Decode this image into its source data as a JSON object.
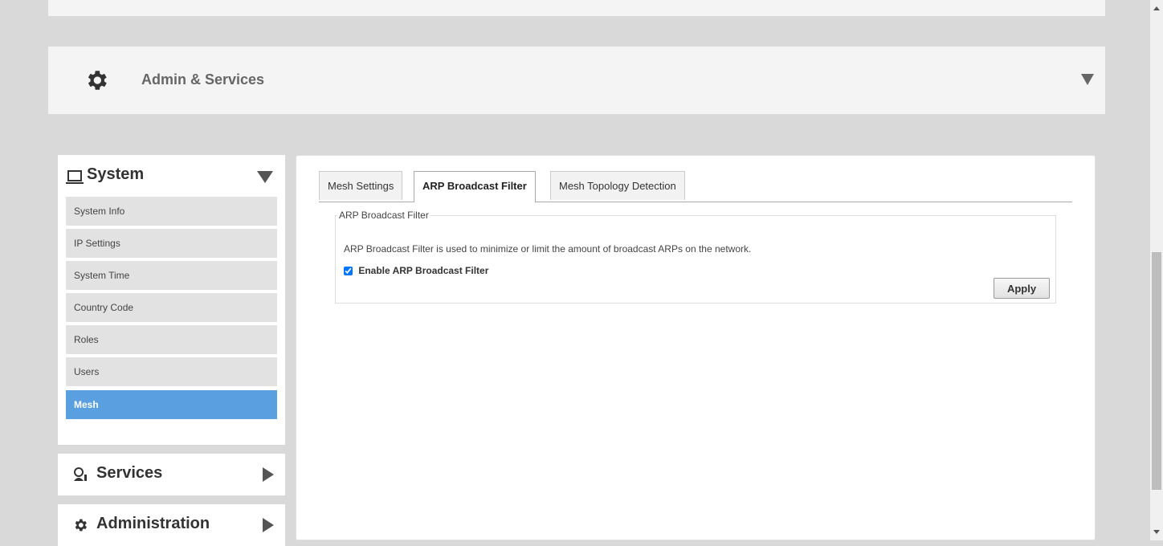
{
  "admin_section": {
    "title": "Admin & Services"
  },
  "sidebar": {
    "system_label": "System",
    "items": [
      {
        "label": "System Info",
        "active": false
      },
      {
        "label": "IP Settings",
        "active": false
      },
      {
        "label": "System Time",
        "active": false
      },
      {
        "label": "Country Code",
        "active": false
      },
      {
        "label": "Roles",
        "active": false
      },
      {
        "label": "Users",
        "active": false
      },
      {
        "label": "Mesh",
        "active": true
      }
    ],
    "services_label": "Services",
    "administration_label": "Administration"
  },
  "tabs": [
    {
      "label": "Mesh Settings",
      "active": false
    },
    {
      "label": "ARP Broadcast Filter",
      "active": true
    },
    {
      "label": "Mesh Topology Detection",
      "active": false
    }
  ],
  "arp_filter": {
    "legend": "ARP Broadcast Filter",
    "description": "ARP Broadcast Filter is used to minimize or limit the amount of broadcast ARPs on the network.",
    "checkbox_label": "Enable ARP Broadcast Filter",
    "checkbox_checked": true,
    "apply_label": "Apply"
  },
  "colors": {
    "active_nav": "#5a9fe0",
    "page_bg": "#d9d9d9",
    "panel_bg": "#f4f4f4"
  },
  "icons": [
    "gear-icon",
    "laptop-icon",
    "caret-down-icon",
    "services-icon",
    "caret-right-icon"
  ]
}
